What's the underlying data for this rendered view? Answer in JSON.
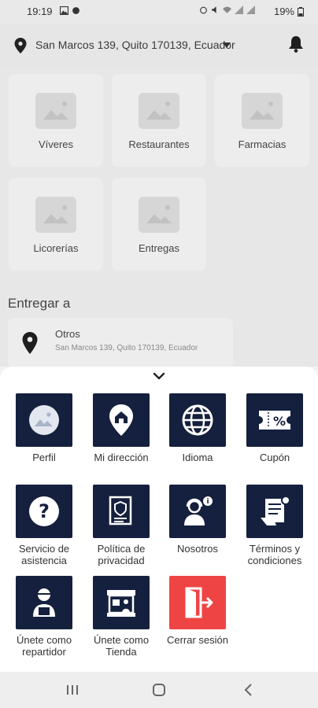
{
  "status_bar": {
    "time": "19:19",
    "battery": "19%"
  },
  "header": {
    "address": "San Marcos 139, Quito 170139, Ecuador"
  },
  "categories": [
    {
      "label": "Víveres"
    },
    {
      "label": "Restaurantes"
    },
    {
      "label": "Farmacias"
    },
    {
      "label": "Licorerías"
    },
    {
      "label": "Entregas"
    }
  ],
  "delivery": {
    "title": "Entregar a",
    "card_title": "Otros",
    "card_address": "San Marcos 139, Quito 170139, Ecuador"
  },
  "menu": {
    "items": [
      {
        "label": "Perfil",
        "icon": "profile-image-icon"
      },
      {
        "label": "Mi dirección",
        "icon": "home-pin-icon"
      },
      {
        "label": "Idioma",
        "icon": "globe-icon"
      },
      {
        "label": "Cupón",
        "icon": "coupon-icon"
      },
      {
        "label": "Servicio de\nasistencia",
        "icon": "help-icon"
      },
      {
        "label": "Política de\nprivacidad",
        "icon": "privacy-icon"
      },
      {
        "label": "Nosotros",
        "icon": "support-agent-icon"
      },
      {
        "label": "Términos y\ncondiciones",
        "icon": "terms-icon"
      },
      {
        "label": "Únete como\nrepartidor",
        "icon": "courier-icon"
      },
      {
        "label": "Únete como\nTienda",
        "icon": "store-icon"
      },
      {
        "label": "Cerrar sesión",
        "icon": "logout-icon"
      }
    ]
  },
  "colors": {
    "tile": "#14203d",
    "logout": "#ef4444"
  }
}
